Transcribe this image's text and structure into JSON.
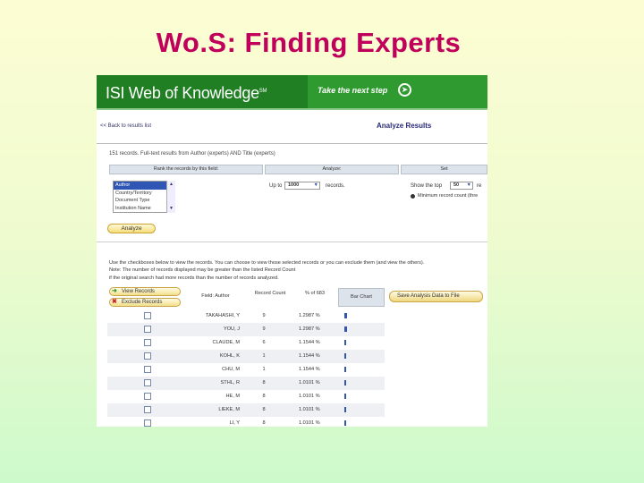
{
  "slide": {
    "title": "Wo.S: Finding Experts"
  },
  "banner": {
    "brand": "ISI Web of Knowledge",
    "brand_mark": "SM",
    "next_step": "Take the next step",
    "next_icon": "arrow-circle-icon"
  },
  "nav": {
    "back_link": "<< Back to results list",
    "page_heading": "Analyze Results"
  },
  "summary": {
    "records_line": "151 records. Full-text results from Author (experts) AND Title (experts)"
  },
  "rank_section": {
    "header_rank": "Rank the records by this field:",
    "header_analyze": "Analyze:",
    "header_set": "Set",
    "fields": [
      "Author",
      "Country/Territory",
      "Document Type",
      "Institution Name"
    ],
    "selected_field": "Author",
    "upto_label": "Up to",
    "upto_value": "1000",
    "records_label": "records.",
    "show_label": "Show the top",
    "show_value": "50",
    "show_after": "re",
    "radio_label": "Minimum record count (thre",
    "analyze_button": "Analyze"
  },
  "help_text": [
    "Use the checkboxes below to view the records. You can choose to view those selected records or you can exclude them (and view the others).",
    "Note: The number of records displayed may be greater than the listed Record Count",
    "if the original search had more records than the number of records analyzed."
  ],
  "actions": {
    "view_records": "View Records",
    "exclude_records": "Exclude Records",
    "save_analysis": "Save Analysis Data to File"
  },
  "table": {
    "col_author": "Field: Author",
    "col_count": "Record Count",
    "col_pct": "% of 683",
    "col_bar": "Bar Chart",
    "rows": [
      {
        "author": "TAKAHASHI, Y",
        "count": "9",
        "pct": "1.2987 %",
        "bar": 0.9
      },
      {
        "author": "YOU, J",
        "count": "9",
        "pct": "1.2987 %",
        "bar": 0.9
      },
      {
        "author": "CLAUDE, M",
        "count": "6",
        "pct": "1.1544 %",
        "bar": 0.7
      },
      {
        "author": "KOHL, K",
        "count": "1",
        "pct": "1.1544 %",
        "bar": 0.7
      },
      {
        "author": "CHU, M",
        "count": "1",
        "pct": "1.1544 %",
        "bar": 0.7
      },
      {
        "author": "STHL, R",
        "count": "8",
        "pct": "1.0101 %",
        "bar": 0.6
      },
      {
        "author": "HE, M",
        "count": "8",
        "pct": "1.0101 %",
        "bar": 0.6
      },
      {
        "author": "LIEKE, M",
        "count": "8",
        "pct": "1.0101 %",
        "bar": 0.6
      },
      {
        "author": "LI, Y",
        "count": "8",
        "pct": "1.0101 %",
        "bar": 0.6
      }
    ]
  }
}
